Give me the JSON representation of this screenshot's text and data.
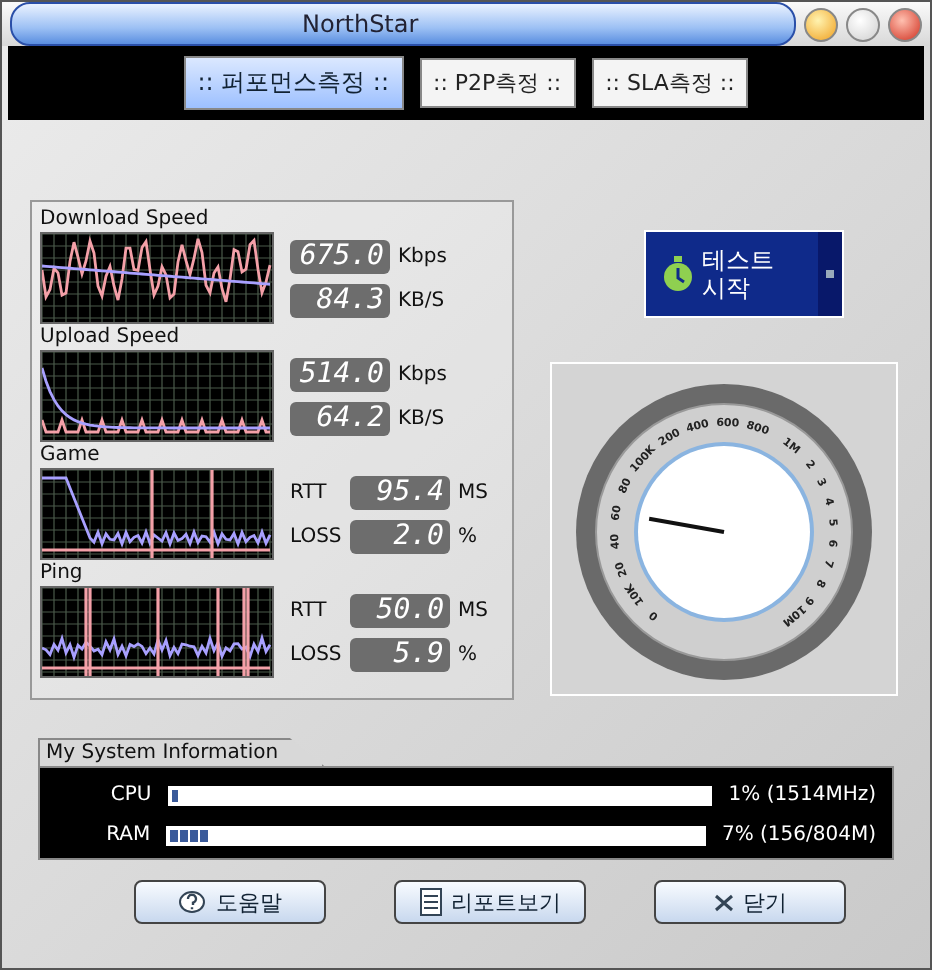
{
  "window": {
    "title": "NorthStar"
  },
  "tabs": [
    {
      "label": ":: 퍼포먼스측정 ::",
      "selected": true
    },
    {
      "label": ":: P2P측정 ::",
      "selected": false
    },
    {
      "label": ":: SLA측정 ::",
      "selected": false
    }
  ],
  "monitors": [
    {
      "title": "Download Speed",
      "kind": "speed",
      "readings": [
        {
          "value": "675.0",
          "unit": "Kbps"
        },
        {
          "value": "84.3",
          "unit": "KB/S"
        }
      ]
    },
    {
      "title": "Upload Speed",
      "kind": "speed",
      "readings": [
        {
          "value": "514.0",
          "unit": "Kbps"
        },
        {
          "value": "64.2",
          "unit": "KB/S"
        }
      ]
    },
    {
      "title": "Game",
      "kind": "latency",
      "readings": [
        {
          "label": "RTT",
          "value": "95.4",
          "unit": "MS"
        },
        {
          "label": "LOSS",
          "value": "2.0",
          "unit": "%"
        }
      ]
    },
    {
      "title": "Ping",
      "kind": "latency",
      "readings": [
        {
          "label": "RTT",
          "value": "50.0",
          "unit": "MS"
        },
        {
          "label": "LOSS",
          "value": "5.9",
          "unit": "%"
        }
      ]
    }
  ],
  "start_button": {
    "label": "테스트\n시작"
  },
  "gauge": {
    "labels": [
      "0",
      "10K",
      "20",
      "40",
      "60",
      "80",
      "100K",
      "200",
      "400",
      "600",
      "800",
      "1M",
      "2",
      "3",
      "4",
      "5",
      "6",
      "7",
      "8",
      "9",
      "10M"
    ]
  },
  "system_info": {
    "title": "My System Information",
    "rows": [
      {
        "label": "CPU",
        "level": 0.01,
        "reading": "1% (1514MHz)"
      },
      {
        "label": "RAM",
        "level": 0.07,
        "reading": "7% (156/804M)"
      }
    ]
  },
  "buttons": [
    {
      "label": "도움말",
      "kind": "help"
    },
    {
      "label": "리포트보기",
      "kind": "report"
    },
    {
      "label": "닫기",
      "kind": "close"
    }
  ]
}
